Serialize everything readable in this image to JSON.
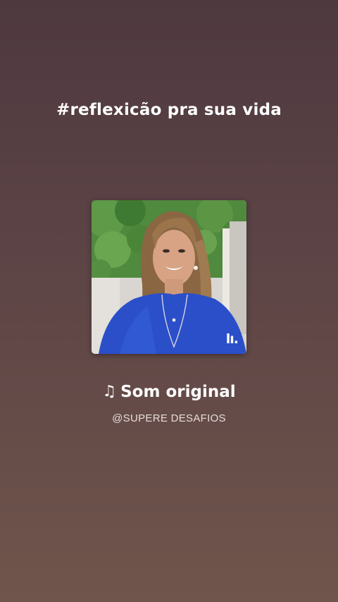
{
  "post": {
    "caption": "#reflexicão pra sua vida"
  },
  "audio": {
    "cover_logo": "lı.",
    "note_icon": "♫",
    "title": "Som original",
    "author": "@SUPERE DESAFIOS"
  },
  "colors": {
    "background_top": "#4e393f",
    "background_bottom": "#6f554b",
    "sweater_blue": "#2a4fc9",
    "foliage_green": "#4f8a3e"
  }
}
